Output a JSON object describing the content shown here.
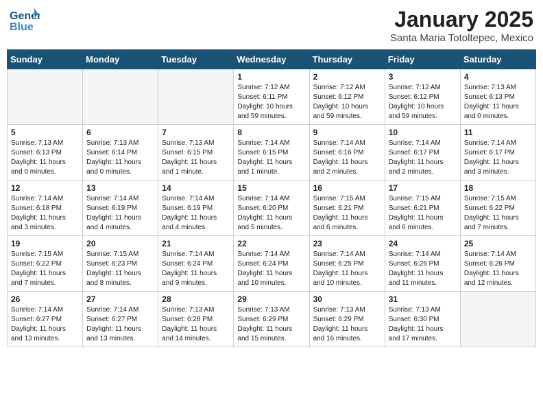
{
  "header": {
    "logo_text_top": "General",
    "logo_text_bottom": "Blue",
    "month": "January 2025",
    "location": "Santa Maria Totoltepec, Mexico"
  },
  "days_of_week": [
    "Sunday",
    "Monday",
    "Tuesday",
    "Wednesday",
    "Thursday",
    "Friday",
    "Saturday"
  ],
  "weeks": [
    [
      {
        "num": "",
        "sunrise": "",
        "sunset": "",
        "daylight": "",
        "empty": true
      },
      {
        "num": "",
        "sunrise": "",
        "sunset": "",
        "daylight": "",
        "empty": true
      },
      {
        "num": "",
        "sunrise": "",
        "sunset": "",
        "daylight": "",
        "empty": true
      },
      {
        "num": "1",
        "sunrise": "Sunrise: 7:12 AM",
        "sunset": "Sunset: 6:11 PM",
        "daylight": "Daylight: 10 hours and 59 minutes."
      },
      {
        "num": "2",
        "sunrise": "Sunrise: 7:12 AM",
        "sunset": "Sunset: 6:12 PM",
        "daylight": "Daylight: 10 hours and 59 minutes."
      },
      {
        "num": "3",
        "sunrise": "Sunrise: 7:12 AM",
        "sunset": "Sunset: 6:12 PM",
        "daylight": "Daylight: 10 hours and 59 minutes."
      },
      {
        "num": "4",
        "sunrise": "Sunrise: 7:13 AM",
        "sunset": "Sunset: 6:13 PM",
        "daylight": "Daylight: 11 hours and 0 minutes."
      }
    ],
    [
      {
        "num": "5",
        "sunrise": "Sunrise: 7:13 AM",
        "sunset": "Sunset: 6:13 PM",
        "daylight": "Daylight: 11 hours and 0 minutes."
      },
      {
        "num": "6",
        "sunrise": "Sunrise: 7:13 AM",
        "sunset": "Sunset: 6:14 PM",
        "daylight": "Daylight: 11 hours and 0 minutes."
      },
      {
        "num": "7",
        "sunrise": "Sunrise: 7:13 AM",
        "sunset": "Sunset: 6:15 PM",
        "daylight": "Daylight: 11 hours and 1 minute."
      },
      {
        "num": "8",
        "sunrise": "Sunrise: 7:14 AM",
        "sunset": "Sunset: 6:15 PM",
        "daylight": "Daylight: 11 hours and 1 minute."
      },
      {
        "num": "9",
        "sunrise": "Sunrise: 7:14 AM",
        "sunset": "Sunset: 6:16 PM",
        "daylight": "Daylight: 11 hours and 2 minutes."
      },
      {
        "num": "10",
        "sunrise": "Sunrise: 7:14 AM",
        "sunset": "Sunset: 6:17 PM",
        "daylight": "Daylight: 11 hours and 2 minutes."
      },
      {
        "num": "11",
        "sunrise": "Sunrise: 7:14 AM",
        "sunset": "Sunset: 6:17 PM",
        "daylight": "Daylight: 11 hours and 3 minutes."
      }
    ],
    [
      {
        "num": "12",
        "sunrise": "Sunrise: 7:14 AM",
        "sunset": "Sunset: 6:18 PM",
        "daylight": "Daylight: 11 hours and 3 minutes."
      },
      {
        "num": "13",
        "sunrise": "Sunrise: 7:14 AM",
        "sunset": "Sunset: 6:19 PM",
        "daylight": "Daylight: 11 hours and 4 minutes."
      },
      {
        "num": "14",
        "sunrise": "Sunrise: 7:14 AM",
        "sunset": "Sunset: 6:19 PM",
        "daylight": "Daylight: 11 hours and 4 minutes."
      },
      {
        "num": "15",
        "sunrise": "Sunrise: 7:14 AM",
        "sunset": "Sunset: 6:20 PM",
        "daylight": "Daylight: 11 hours and 5 minutes."
      },
      {
        "num": "16",
        "sunrise": "Sunrise: 7:15 AM",
        "sunset": "Sunset: 6:21 PM",
        "daylight": "Daylight: 11 hours and 6 minutes."
      },
      {
        "num": "17",
        "sunrise": "Sunrise: 7:15 AM",
        "sunset": "Sunset: 6:21 PM",
        "daylight": "Daylight: 11 hours and 6 minutes."
      },
      {
        "num": "18",
        "sunrise": "Sunrise: 7:15 AM",
        "sunset": "Sunset: 6:22 PM",
        "daylight": "Daylight: 11 hours and 7 minutes."
      }
    ],
    [
      {
        "num": "19",
        "sunrise": "Sunrise: 7:15 AM",
        "sunset": "Sunset: 6:22 PM",
        "daylight": "Daylight: 11 hours and 7 minutes."
      },
      {
        "num": "20",
        "sunrise": "Sunrise: 7:15 AM",
        "sunset": "Sunset: 6:23 PM",
        "daylight": "Daylight: 11 hours and 8 minutes."
      },
      {
        "num": "21",
        "sunrise": "Sunrise: 7:14 AM",
        "sunset": "Sunset: 6:24 PM",
        "daylight": "Daylight: 11 hours and 9 minutes."
      },
      {
        "num": "22",
        "sunrise": "Sunrise: 7:14 AM",
        "sunset": "Sunset: 6:24 PM",
        "daylight": "Daylight: 11 hours and 10 minutes."
      },
      {
        "num": "23",
        "sunrise": "Sunrise: 7:14 AM",
        "sunset": "Sunset: 6:25 PM",
        "daylight": "Daylight: 11 hours and 10 minutes."
      },
      {
        "num": "24",
        "sunrise": "Sunrise: 7:14 AM",
        "sunset": "Sunset: 6:26 PM",
        "daylight": "Daylight: 11 hours and 11 minutes."
      },
      {
        "num": "25",
        "sunrise": "Sunrise: 7:14 AM",
        "sunset": "Sunset: 6:26 PM",
        "daylight": "Daylight: 11 hours and 12 minutes."
      }
    ],
    [
      {
        "num": "26",
        "sunrise": "Sunrise: 7:14 AM",
        "sunset": "Sunset: 6:27 PM",
        "daylight": "Daylight: 11 hours and 13 minutes."
      },
      {
        "num": "27",
        "sunrise": "Sunrise: 7:14 AM",
        "sunset": "Sunset: 6:27 PM",
        "daylight": "Daylight: 11 hours and 13 minutes."
      },
      {
        "num": "28",
        "sunrise": "Sunrise: 7:13 AM",
        "sunset": "Sunset: 6:28 PM",
        "daylight": "Daylight: 11 hours and 14 minutes."
      },
      {
        "num": "29",
        "sunrise": "Sunrise: 7:13 AM",
        "sunset": "Sunset: 6:29 PM",
        "daylight": "Daylight: 11 hours and 15 minutes."
      },
      {
        "num": "30",
        "sunrise": "Sunrise: 7:13 AM",
        "sunset": "Sunset: 6:29 PM",
        "daylight": "Daylight: 11 hours and 16 minutes."
      },
      {
        "num": "31",
        "sunrise": "Sunrise: 7:13 AM",
        "sunset": "Sunset: 6:30 PM",
        "daylight": "Daylight: 11 hours and 17 minutes."
      },
      {
        "num": "",
        "sunrise": "",
        "sunset": "",
        "daylight": "",
        "empty": true
      }
    ]
  ]
}
